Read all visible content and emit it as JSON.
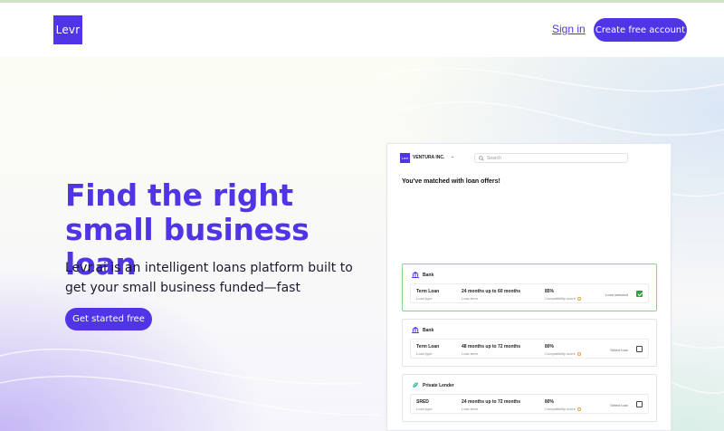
{
  "nav": {
    "logo_text": "Levr",
    "sign_in_label": "Sign in",
    "create_account_label": "Create free account"
  },
  "hero": {
    "title": "Find the right small business loan",
    "subtitle": "Levr.ai is an intelligent loans platform built to get your small business funded—fast",
    "cta_label": "Get started free"
  },
  "preview": {
    "logo_text": "Levr",
    "company": "VENTURA INC.",
    "search_placeholder": "Search",
    "heading": "You've matched with loan offers!",
    "offers": [
      {
        "lender": "Bank",
        "lender_icon": "bank-icon",
        "loan_type": "Term Loan",
        "loan_type_label": "Loan type",
        "term": "24 months up to 60 months",
        "term_label": "Loan term",
        "score": "85%",
        "score_label": "Compatibility score",
        "action_label": "Loan selected",
        "selected": true
      },
      {
        "lender": "Bank",
        "lender_icon": "bank-icon",
        "loan_type": "Term Loan",
        "loan_type_label": "Loan type",
        "term": "48 months up to 72 months",
        "term_label": "Loan term",
        "score": "80%",
        "score_label": "Compatibility score",
        "action_label": "Select loan",
        "selected": false
      },
      {
        "lender": "Private Lender",
        "lender_icon": "private-lender-icon",
        "loan_type": "SRED",
        "loan_type_label": "Loan type",
        "term": "24 months up to 72 months",
        "term_label": "Loan term",
        "score": "80%",
        "score_label": "Compatibility score",
        "action_label": "Select loan",
        "selected": false
      }
    ]
  },
  "colors": {
    "brand": "#4f35e6",
    "selected_border": "#8fd18a",
    "checkbox_checked": "#2aa339"
  }
}
